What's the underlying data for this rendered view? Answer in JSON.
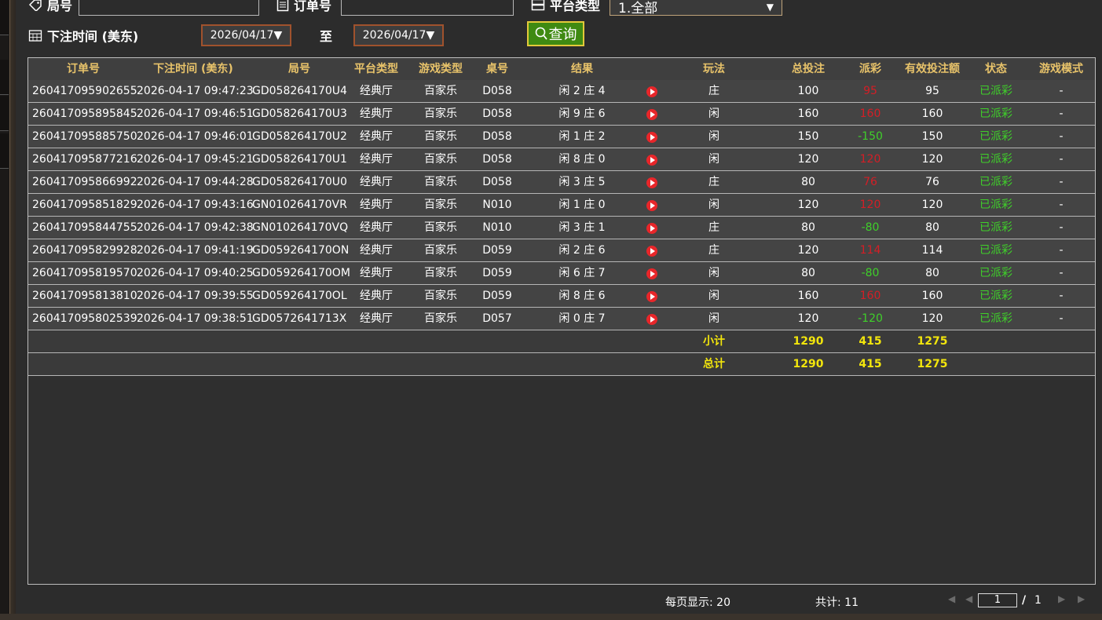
{
  "filters": {
    "round_label": "局号",
    "round_value": "",
    "order_label": "订单号",
    "order_value": "",
    "platform_label": "平台类型",
    "platform_value": "1.全部",
    "bet_time_label": "下注时间 (美东)",
    "date_from": "2026/04/17▼",
    "to_label": "至",
    "date_to": "2026/04/17▼",
    "query_label": "查询"
  },
  "table": {
    "headers": [
      "订单号",
      "下注时间 (美东)",
      "局号",
      "平台类型",
      "游戏类型",
      "桌号",
      "结果",
      "",
      "玩法",
      "总投注",
      "派彩",
      "有效投注额",
      "状态",
      "游戏模式"
    ],
    "rows": [
      {
        "order": "260417095902655",
        "time": "2026-04-17 09:47:23",
        "round": "GD058264170U4",
        "platform": "经典厅",
        "game": "百家乐",
        "table": "D058",
        "result": "闲 2 庄 4",
        "play": "庄",
        "bet": "100",
        "payout": "95",
        "valid": "95",
        "status": "已派彩",
        "mode": "-",
        "payout_class": "pos"
      },
      {
        "order": "260417095895845",
        "time": "2026-04-17 09:46:51",
        "round": "GD058264170U3",
        "platform": "经典厅",
        "game": "百家乐",
        "table": "D058",
        "result": "闲 9 庄 6",
        "play": "闲",
        "bet": "160",
        "payout": "160",
        "valid": "160",
        "status": "已派彩",
        "mode": "-",
        "payout_class": "pos"
      },
      {
        "order": "260417095885750",
        "time": "2026-04-17 09:46:01",
        "round": "GD058264170U2",
        "platform": "经典厅",
        "game": "百家乐",
        "table": "D058",
        "result": "闲 1 庄 2",
        "play": "闲",
        "bet": "150",
        "payout": "-150",
        "valid": "150",
        "status": "已派彩",
        "mode": "-",
        "payout_class": "neg"
      },
      {
        "order": "260417095877216",
        "time": "2026-04-17 09:45:21",
        "round": "GD058264170U1",
        "platform": "经典厅",
        "game": "百家乐",
        "table": "D058",
        "result": "闲 8 庄 0",
        "play": "闲",
        "bet": "120",
        "payout": "120",
        "valid": "120",
        "status": "已派彩",
        "mode": "-",
        "payout_class": "pos"
      },
      {
        "order": "260417095866992",
        "time": "2026-04-17 09:44:28",
        "round": "GD058264170U0",
        "platform": "经典厅",
        "game": "百家乐",
        "table": "D058",
        "result": "闲 3 庄 5",
        "play": "庄",
        "bet": "80",
        "payout": "76",
        "valid": "76",
        "status": "已派彩",
        "mode": "-",
        "payout_class": "pos"
      },
      {
        "order": "260417095851829",
        "time": "2026-04-17 09:43:16",
        "round": "GN010264170VR",
        "platform": "经典厅",
        "game": "百家乐",
        "table": "N010",
        "result": "闲 1 庄 0",
        "play": "闲",
        "bet": "120",
        "payout": "120",
        "valid": "120",
        "status": "已派彩",
        "mode": "-",
        "payout_class": "pos"
      },
      {
        "order": "260417095844755",
        "time": "2026-04-17 09:42:38",
        "round": "GN010264170VQ",
        "platform": "经典厅",
        "game": "百家乐",
        "table": "N010",
        "result": "闲 3 庄 1",
        "play": "庄",
        "bet": "80",
        "payout": "-80",
        "valid": "80",
        "status": "已派彩",
        "mode": "-",
        "payout_class": "neg"
      },
      {
        "order": "260417095829928",
        "time": "2026-04-17 09:41:19",
        "round": "GD059264170ON",
        "platform": "经典厅",
        "game": "百家乐",
        "table": "D059",
        "result": "闲 2 庄 6",
        "play": "庄",
        "bet": "120",
        "payout": "114",
        "valid": "114",
        "status": "已派彩",
        "mode": "-",
        "payout_class": "pos"
      },
      {
        "order": "260417095819570",
        "time": "2026-04-17 09:40:25",
        "round": "GD059264170OM",
        "platform": "经典厅",
        "game": "百家乐",
        "table": "D059",
        "result": "闲 6 庄 7",
        "play": "闲",
        "bet": "80",
        "payout": "-80",
        "valid": "80",
        "status": "已派彩",
        "mode": "-",
        "payout_class": "neg"
      },
      {
        "order": "260417095813810",
        "time": "2026-04-17 09:39:55",
        "round": "GD059264170OL",
        "platform": "经典厅",
        "game": "百家乐",
        "table": "D059",
        "result": "闲 8 庄 6",
        "play": "闲",
        "bet": "160",
        "payout": "160",
        "valid": "160",
        "status": "已派彩",
        "mode": "-",
        "payout_class": "pos"
      },
      {
        "order": "260417095802539",
        "time": "2026-04-17 09:38:51",
        "round": "GD0572641713X",
        "platform": "经典厅",
        "game": "百家乐",
        "table": "D057",
        "result": "闲 0 庄 7",
        "play": "闲",
        "bet": "120",
        "payout": "-120",
        "valid": "120",
        "status": "已派彩",
        "mode": "-",
        "payout_class": "neg"
      }
    ],
    "subtotal": {
      "label": "小计",
      "bet": "1290",
      "payout": "415",
      "valid": "1275"
    },
    "total": {
      "label": "总计",
      "bet": "1290",
      "payout": "415",
      "valid": "1275"
    }
  },
  "footer": {
    "per_page": "每页显示: 20",
    "total_count": "共计: 11",
    "page": "1",
    "sep": "/",
    "pages": "1"
  }
}
